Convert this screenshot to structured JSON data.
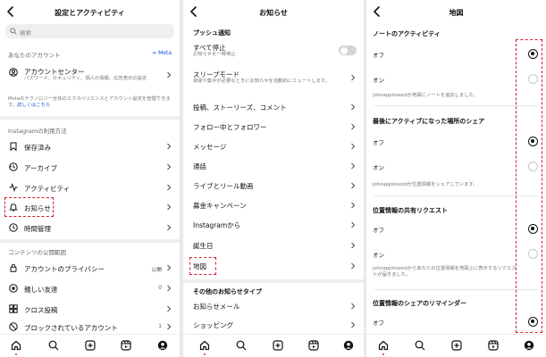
{
  "colors": {
    "accent_red": "#d7192c",
    "link_blue": "#1a57d6",
    "toggle_off": "#d4d4d4",
    "notification_dot": "#e0245e"
  },
  "panel1": {
    "title": "設定とアクティビティ",
    "search_placeholder": "検索",
    "account_section": "あなたのアカウント",
    "meta_label": "∞ Meta",
    "account_center": {
      "title": "アカウントセンター",
      "subtitle": "パスワード、セキュリティ、個人の情報、広告表示の設定"
    },
    "meta_note": "Metaのテクノロジー全体のエクスペリエンスとアカウント設定を管理できます。",
    "meta_note_link": "詳しくはこちら",
    "usage_section": "Instagramの利用方法",
    "usage_items": [
      {
        "label": "保存済み",
        "icon": "bookmark-icon"
      },
      {
        "label": "アーカイブ",
        "icon": "archive-icon"
      },
      {
        "label": "アクティビティ",
        "icon": "activity-icon"
      },
      {
        "label": "お知らせ",
        "icon": "bell-icon"
      },
      {
        "label": "時間管理",
        "icon": "clock-icon"
      }
    ],
    "visibility_section": "コンテンツの公開範囲",
    "visibility_items": [
      {
        "label": "アカウントのプライバシー",
        "value": "公開",
        "icon": "lock-icon"
      },
      {
        "label": "親しい友達",
        "value": "0",
        "icon": "star-icon"
      },
      {
        "label": "クロス投稿",
        "value": "",
        "icon": "crosspost-icon"
      },
      {
        "label": "ブロックされているアカウント",
        "value": "1",
        "icon": "block-icon"
      }
    ]
  },
  "panel2": {
    "title": "お知らせ",
    "push_section": "プッシュ通知",
    "pause_all": {
      "title": "すべて停止",
      "subtitle": "お知らせを一時停止"
    },
    "sleep_mode": {
      "title": "スリープモード",
      "subtitle": "夜間や集中が必要なときにお知らせを自動的にミュートします。"
    },
    "items": [
      "投稿、ストーリーズ、コメント",
      "フォロー中とフォロワー",
      "メッセージ",
      "通話",
      "ライブとリール動画",
      "募金キャンペーン",
      "Instagramから",
      "誕生日",
      "地図"
    ],
    "other_section": "その他のお知らせタイプ",
    "other_items": [
      "お知らせメール",
      "ショッピング"
    ]
  },
  "panel3": {
    "title": "地図",
    "groups": [
      {
        "heading": "ノートのアクティビティ",
        "off": "オフ",
        "on": "オン",
        "selected": "off",
        "note": "johnappleseedが地図にノートを追加しました。"
      },
      {
        "heading": "最後にアクティブになった場所のシェア",
        "off": "オフ",
        "on": "オン",
        "selected": "off",
        "note": "johnappleseedが位置情報をシェアしています。"
      },
      {
        "heading": "位置情報の共有リクエスト",
        "off": "オフ",
        "on": "オン",
        "selected": "off",
        "note": "johnappleseedからあなたの位置情報を地図上に表示するリクエストが届きました。"
      },
      {
        "heading": "位置情報のシェアのリマインダー",
        "off": "オフ",
        "selected": "off"
      }
    ]
  },
  "nav_icons": [
    "home-icon",
    "search-icon",
    "create-icon",
    "reels-icon",
    "profile-icon"
  ]
}
